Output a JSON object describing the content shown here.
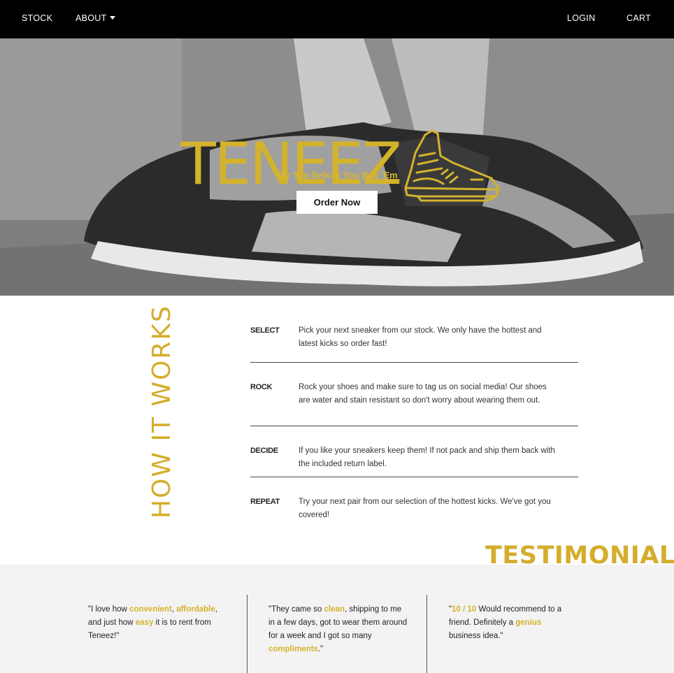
{
  "nav": {
    "stock": "STOCK",
    "about": "ABOUT",
    "login": "LOGIN",
    "cart": "CART"
  },
  "hero": {
    "brand": "TENEEZ",
    "tagline": "Try 'Em Before You Buy 'Em",
    "order_button": "Order Now"
  },
  "how": {
    "title": "HOW IT WORKS",
    "steps": [
      {
        "label": "SELECT",
        "text": "Pick your next sneaker from our stock. We only have the hottest and latest kicks so order fast!"
      },
      {
        "label": "ROCK",
        "text": "Rock your shoes and make sure to tag us on social media! Our shoes are water and stain resistant so don't worry about wearing them out."
      },
      {
        "label": "DECIDE",
        "text": "If you like your sneakers keep them! If not pack and ship them back with the included return label."
      },
      {
        "label": "REPEAT",
        "text": "Try your next pair from our selection of the hottest kicks. We've got you covered!"
      }
    ]
  },
  "testimonials": {
    "title": "TESTIMONIALS",
    "q1": {
      "a": "\"I love how ",
      "h1": "convenient",
      "b": ", ",
      "h2": "affordable",
      "c": ", and just how ",
      "h3": "easy",
      "d": " it is to rent from Teneez!\""
    },
    "q2": {
      "a": "\"They came so ",
      "h1": "clean",
      "b": ", shipping to me in a few days, got to wear them around for a week and I got so many ",
      "h2": "compliments",
      "c": ".\""
    },
    "q3": {
      "a": "\"",
      "h1": "10 / 10",
      "b": " Would recommend to a friend. Definitely a ",
      "h2": "genius",
      "c": " business idea.\""
    }
  },
  "colors": {
    "accent": "#d4b32c",
    "nav_bg": "#000000",
    "band_bg": "#f3f3f3"
  }
}
